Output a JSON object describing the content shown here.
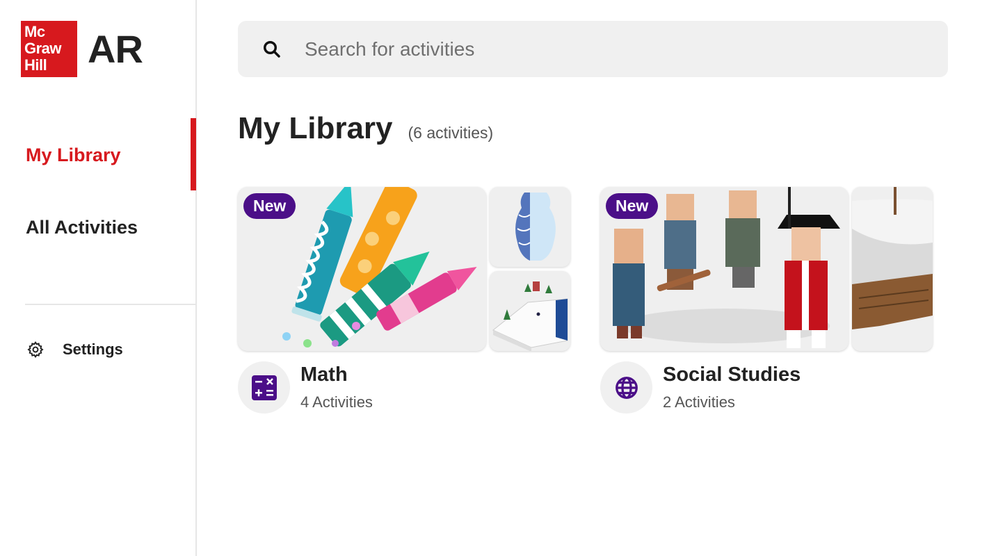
{
  "app": {
    "logo_lines": [
      "Mc",
      "Graw",
      "Hill"
    ],
    "logo_suffix": "AR",
    "brand_color": "#d7191e",
    "accent_color": "#4b0f88"
  },
  "sidebar": {
    "items": [
      {
        "label": "My Library",
        "active": true
      },
      {
        "label": "All Activities",
        "active": false
      }
    ],
    "settings_label": "Settings",
    "settings_icon": "gear-icon"
  },
  "search": {
    "placeholder": "Search for activities",
    "value": "",
    "icon": "search-icon"
  },
  "main": {
    "title": "My Library",
    "count": "(6 activities)",
    "cards": [
      {
        "title": "Math",
        "subtitle": "4 Activities",
        "badge": "New",
        "icon": "math-operations-icon"
      },
      {
        "title": "Social Studies",
        "subtitle": "2 Activities",
        "badge": "New",
        "icon": "globe-icon"
      }
    ]
  }
}
